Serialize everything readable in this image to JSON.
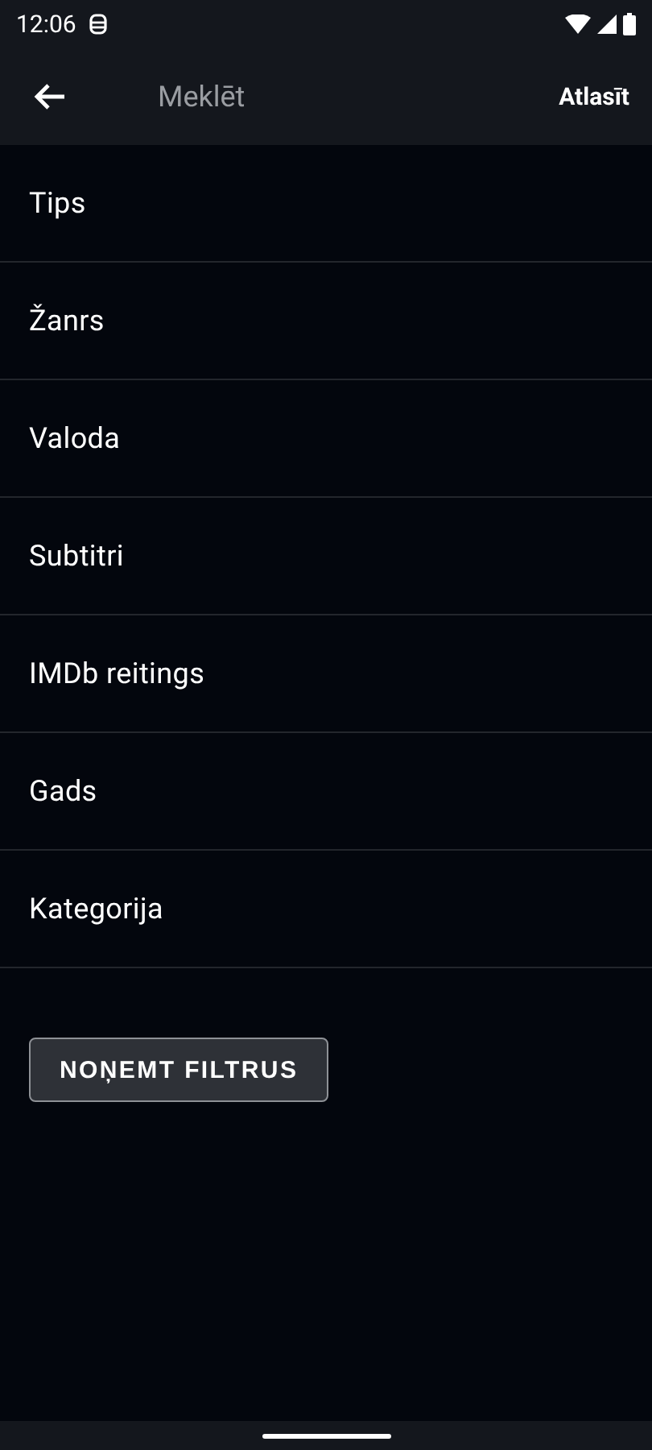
{
  "status_bar": {
    "time": "12:06"
  },
  "toolbar": {
    "title": "Meklēt",
    "action": "Atlasīt"
  },
  "filters": [
    {
      "label": "Tips"
    },
    {
      "label": "Žanrs"
    },
    {
      "label": "Valoda"
    },
    {
      "label": "Subtitri"
    },
    {
      "label": "IMDb reitings"
    },
    {
      "label": "Gads"
    },
    {
      "label": "Kategorija"
    }
  ],
  "clear_button": "NOŅEMT FILTRUS"
}
